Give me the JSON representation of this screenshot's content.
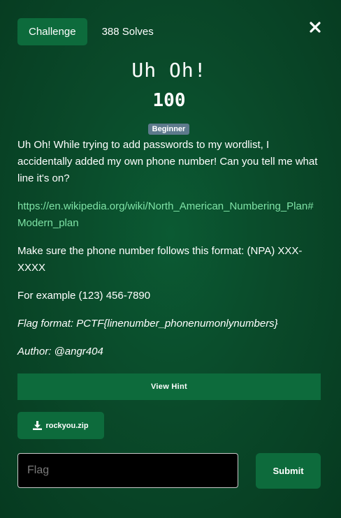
{
  "header": {
    "tab_challenge": "Challenge",
    "solves": "388 Solves"
  },
  "challenge": {
    "title": "Uh Oh!",
    "points": "100",
    "difficulty": "Beginner",
    "description": "Uh Oh! While trying to add passwords to my wordlist, I accidentally added my own phone number! Can you tell me what line it's on?",
    "link": "https://en.wikipedia.org/wiki/North_American_Numbering_Plan#Modern_plan",
    "format_note": "Make sure the phone number follows this format: (NPA) XXX-XXXX",
    "example": "For example (123) 456-7890",
    "flag_format": "Flag format: PCTF{linenumber_phonenumonlynumbers}",
    "author": "Author: @angr404"
  },
  "actions": {
    "hint_label": "View Hint",
    "file_label": "rockyou.zip",
    "flag_placeholder": "Flag",
    "submit_label": "Submit"
  },
  "colors": {
    "accent": "#0d6b3c",
    "link": "#7fe3a6",
    "badge": "#5d7a8c"
  },
  "icons": [
    "close-icon",
    "download-icon"
  ]
}
